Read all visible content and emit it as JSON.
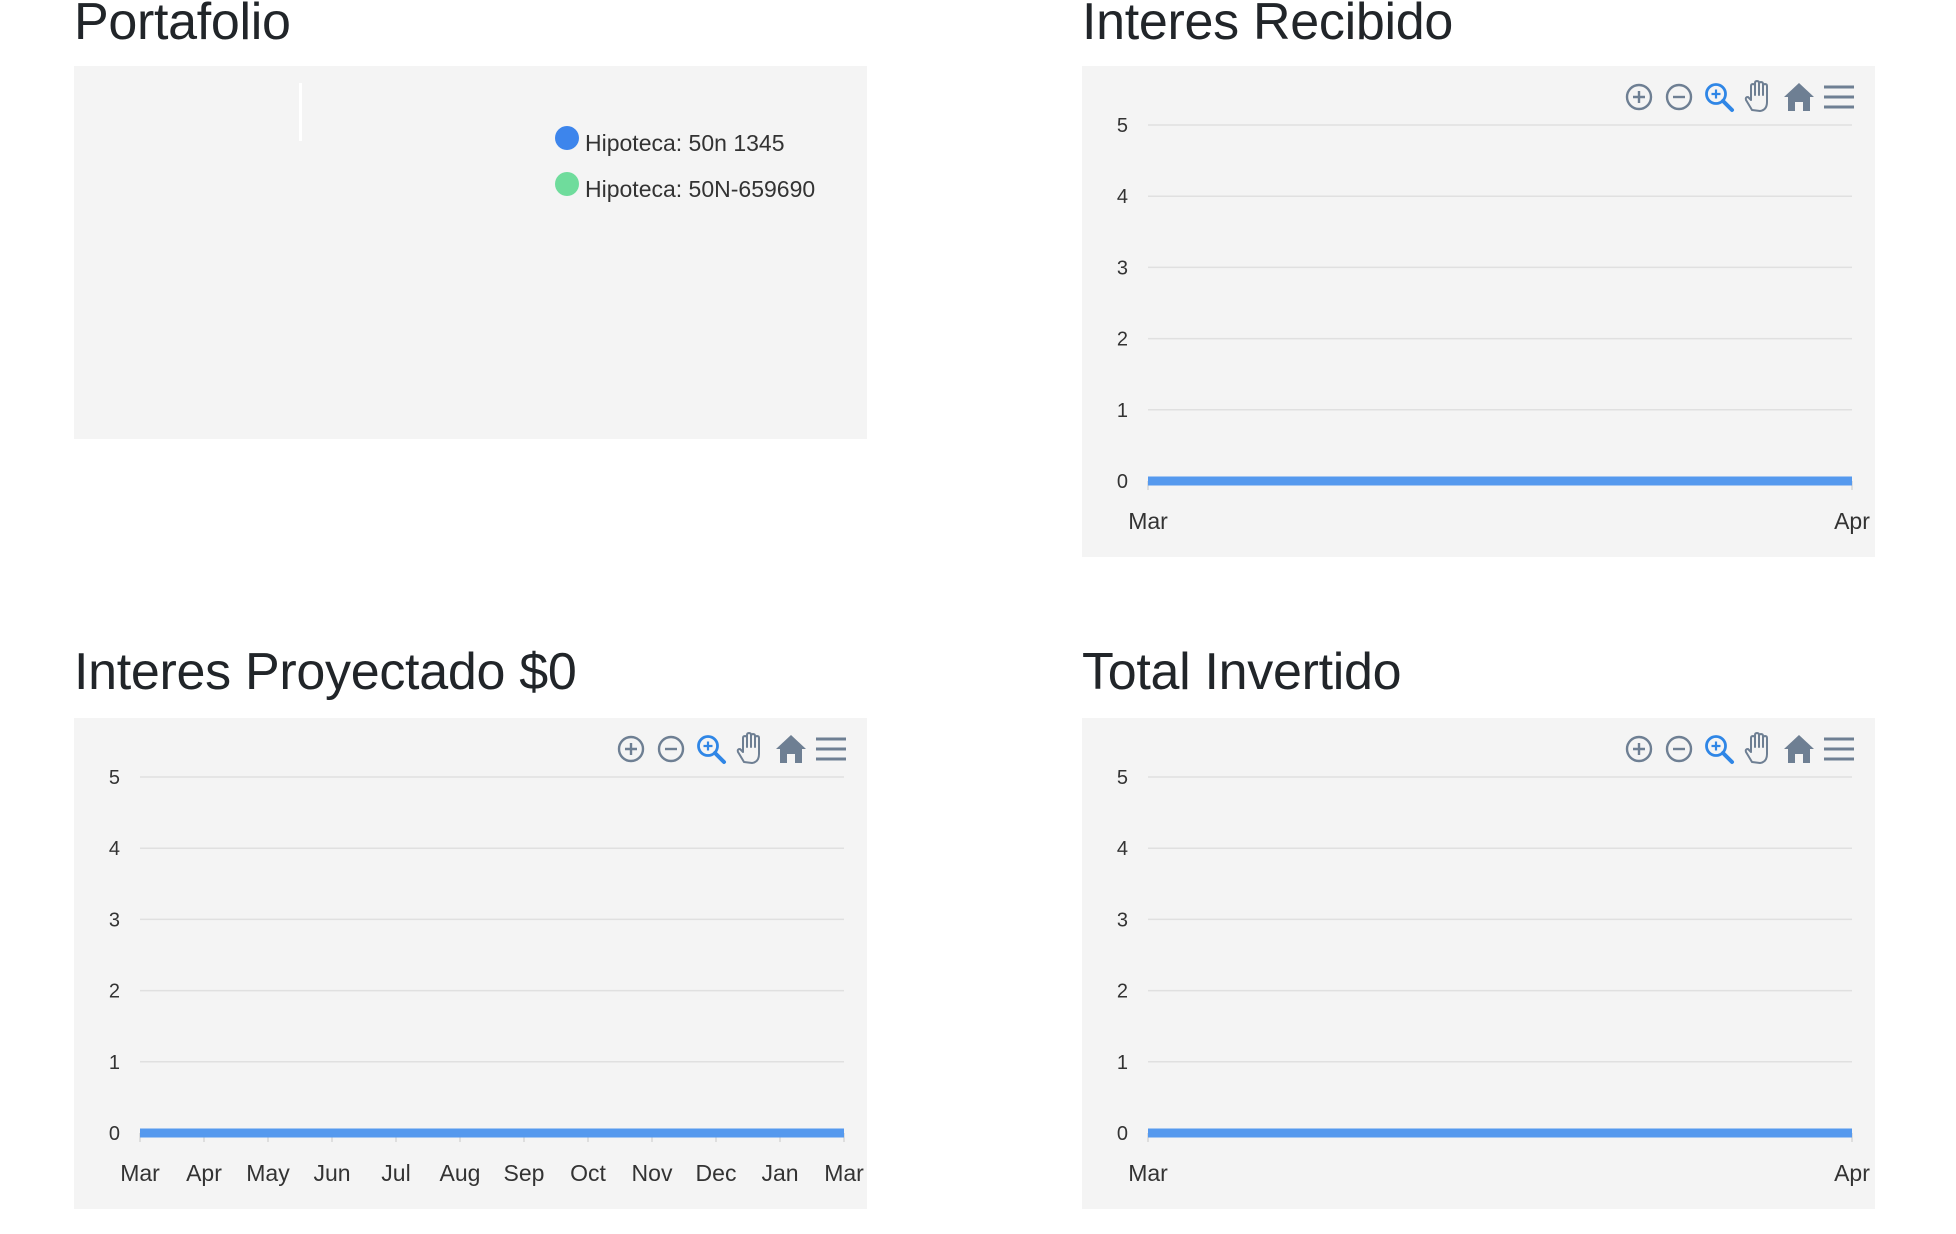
{
  "colors": {
    "series": "#5599ee",
    "grid": "#e0e0e0",
    "panel_bg": "#f4f4f4",
    "icon": "#6e7f93",
    "icon_active": "#2f86e6",
    "legend_blue": "#3d85ec",
    "legend_green": "#6fdc9c"
  },
  "toolbar_icons": [
    "zoom-in-icon",
    "zoom-out-icon",
    "selection-zoom-icon",
    "pan-hand-icon",
    "reset-home-icon",
    "menu-icon"
  ],
  "portfolio": {
    "title": "Portafolio",
    "legend": [
      {
        "label": "Hipoteca: 50n 1345",
        "color": "#3d85ec"
      },
      {
        "label": "Hipoteca: 50N-659690",
        "color": "#6fdc9c"
      }
    ]
  },
  "interes_recibido": {
    "title": "Interes Recibido"
  },
  "interes_proyectado": {
    "title": "Interes Proyectado $0"
  },
  "total_invertido": {
    "title": "Total Invertido"
  },
  "chart_data": [
    {
      "id": "portafolio",
      "type": "pie",
      "categories": [
        "Hipoteca: 50n 1345",
        "Hipoteca: 50N-659690"
      ],
      "values": [
        0,
        0
      ],
      "legend_position": "top-right"
    },
    {
      "id": "interes_recibido",
      "type": "line",
      "x": [
        "Mar",
        "Apr"
      ],
      "series": [
        {
          "values": [
            0,
            0
          ]
        }
      ],
      "y_ticks": [
        "0",
        "1",
        "2",
        "3",
        "4",
        "5"
      ],
      "ylim": [
        0,
        5
      ],
      "grid": true
    },
    {
      "id": "interes_proyectado",
      "type": "line",
      "x": [
        "Mar",
        "Apr",
        "May",
        "Jun",
        "Jul",
        "Aug",
        "Sep",
        "Oct",
        "Nov",
        "Dec",
        "Jan",
        "Mar"
      ],
      "series": [
        {
          "values": [
            0,
            0,
            0,
            0,
            0,
            0,
            0,
            0,
            0,
            0,
            0,
            0
          ]
        }
      ],
      "y_ticks": [
        "0",
        "1",
        "2",
        "3",
        "4",
        "5"
      ],
      "ylim": [
        0,
        5
      ],
      "grid": true
    },
    {
      "id": "total_invertido",
      "type": "line",
      "x": [
        "Mar",
        "Apr"
      ],
      "series": [
        {
          "values": [
            0,
            0
          ]
        }
      ],
      "y_ticks": [
        "0",
        "1",
        "2",
        "3",
        "4",
        "5"
      ],
      "ylim": [
        0,
        5
      ],
      "grid": true
    }
  ]
}
